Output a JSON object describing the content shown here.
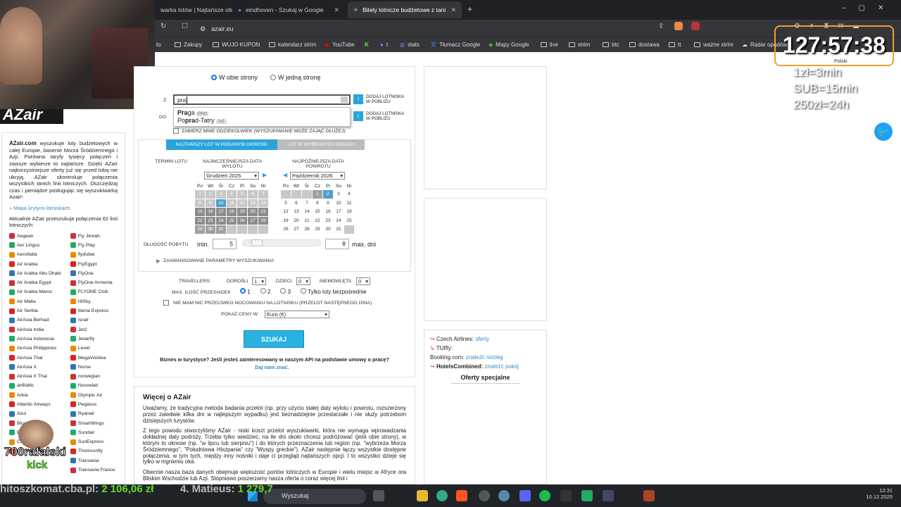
{
  "browser": {
    "tabs": [
      "warka lotów | Najtańsze ofer",
      "eindhoven - Szukaj w Google",
      "Bilety lotnicze budżetowe z tani"
    ],
    "url": "azair.eu",
    "bookmarks": [
      "to",
      "Zakupy",
      "WUJO KUPON",
      "kalendarz strim",
      "YouTube",
      "t",
      "stats",
      "Tłumacz Google",
      "Mapy Google",
      "live",
      "strim",
      "btc",
      "dostawa",
      "tt",
      "ważne strim",
      "Radar opadów",
      "Z"
    ]
  },
  "overlay": {
    "timer": "127:57:38",
    "rule1": "1zł=3min",
    "rule2": "SUB=15min",
    "rule3": "250zł=24h",
    "lang": "Polski"
  },
  "sidebar": {
    "brand": "AZair",
    "intro_bold": "AZair.com",
    "intro": "wyszukuje loty budżetowych w całej Europie, basenie Morza Śródziemnego i Azji. Porówna taryfy tysięcy połączeń i zawsze wybierze to najtańsze. Dzięki AZair najkorzystniejsze oferty już się przed tobą nie ukryją. AZair skontroluje połączenia wszystkich tanich linii lotniczych. Oszczędzaj czas i pieniądze posługując się wyszukiwarką Azair!",
    "map_link": "Mapa krytymi lotniskach",
    "count_text": "Aktualnie AZair przeszukuje połączenia 62 linii lotniczych:",
    "airlines_left": [
      "Aegean",
      "Aer Lingus",
      "AeroItalia",
      "Air Arabia",
      "Air Arabia Abu Dhabi",
      "Air Arabia Egypt",
      "Air Arabia Maroc",
      "Air Malta",
      "Air Serbia",
      "AirAsia Berhad",
      "AirAsia India",
      "AirAsia Indonesia",
      "AirAsia Philippines",
      "AirAsia Thai",
      "AirAsia X",
      "AirAsia X Thai",
      "airBaltic",
      "Arkia",
      "Atlantic Airways",
      "Azul",
      "Blue Air",
      "Blue Islands",
      "Condor",
      "Corendon Dutch"
    ],
    "airlines_right": [
      "Fly Jinnah",
      "Fly Play",
      "flydubai",
      "FlyEgypt",
      "FlyOne",
      "FlyOne Armenia",
      "FLYONE Club",
      "HiSky",
      "Iberia Express",
      "Israir",
      "Jet2",
      "Jetairfly",
      "Level",
      "MegaVolotea",
      "Norse",
      "norwegian",
      "Nouvelair",
      "Olympic Air",
      "Pegasus",
      "Ryanair",
      "SmartWings",
      "Sundair",
      "SunExpress",
      "Thomsonfly",
      "Transavia",
      "Transavia France"
    ]
  },
  "form": {
    "round_trip": "W obie strony",
    "one_way": "W jedną stronę",
    "from_label": "Z",
    "from_value": "pra",
    "to_label": "DO",
    "nearby": "DODAJ LOTNISKA W POBLIŻU",
    "suggestions": [
      {
        "pre": "",
        "bold": "Pra",
        "post": "ga",
        "code": "PRG"
      },
      {
        "pre": "Po",
        "bold": "pra",
        "post": "d-Tatry",
        "code": "TAT"
      }
    ],
    "anywhere": "ZABIERZ MNIE GDZIEKOLWIEK (WYSZUKIWANIE MOŻE ZAJĄĆ DŁUŻEJ)",
    "tab1": "NAJTAŃSZY LOT W PODANYM OKRESIE",
    "tab2": "LOT W WYBRANYCH DNIACH",
    "term_label": "TERMIN LOTU",
    "earliest_label": "NAJWCZEŚNIEJSZA DATA WYLOTU",
    "latest_label": "NAJPÓŹNIEJSZA DATA POWROTU",
    "month1": "Grudzień 2025",
    "month2": "Październik 2026",
    "weekdays": [
      "Po",
      "Wt",
      "Śr",
      "Cz",
      "Pi",
      "So",
      "Ni"
    ],
    "cal1": [
      [
        "1",
        "2",
        "3",
        "4",
        "5",
        "6",
        "7"
      ],
      [
        "8",
        "9",
        "10",
        "11",
        "12",
        "13",
        "14"
      ],
      [
        "15",
        "16",
        "17",
        "18",
        "19",
        "20",
        "21"
      ],
      [
        "22",
        "23",
        "24",
        "25",
        "26",
        "27",
        "28"
      ],
      [
        "29",
        "30",
        "31",
        "",
        "",
        "",
        ""
      ]
    ],
    "cal2": [
      [
        "",
        "",
        "",
        "1",
        "2",
        "3",
        "4"
      ],
      [
        "5",
        "6",
        "7",
        "8",
        "9",
        "10",
        "11"
      ],
      [
        "12",
        "13",
        "14",
        "15",
        "16",
        "17",
        "18"
      ],
      [
        "19",
        "20",
        "21",
        "22",
        "23",
        "24",
        "25"
      ],
      [
        "26",
        "27",
        "28",
        "29",
        "30",
        "31",
        ""
      ]
    ],
    "stay_label": "DŁUGOŚĆ POBYTU",
    "min_label": "min.",
    "min_value": "5",
    "max_value": "8",
    "max_label": "max. dni",
    "advanced": "ZAAWANSOWANE PARAMETRY WYSZUKIWANIA",
    "travellers": "TRAVELLERS:",
    "adults_label": "DOROŚLI",
    "adults": "1",
    "children_label": "DZIECI",
    "children": "0",
    "infants_label": "NIEMOWLĘTA",
    "infants": "0",
    "changes_label": "MAX. ILOŚĆ PRZESIADEK",
    "c1": "1",
    "c2": "2",
    "c3": "3",
    "direct": "Tylko loty bezpośrednie",
    "overnight": "NIE MAM NIC PRZECIWKO NOCOWANIU NA LOTNISKU (PRZELOT NASTĘPNEGO DNIA)",
    "currency_label": "POKAŻ CENY W",
    "currency": "Euro (€)",
    "search": "SZUKAJ",
    "biz": "Biznes w turystyce? Jeśli jesteś zainteresowany w naszym API na podstawie umowy o pracę?",
    "biz_link": "Daj nam znać."
  },
  "right": {
    "l1a": "Czech Airlines:",
    "l1b": "oferty",
    "l2": "TUIfly:",
    "l3a": "Booking.com:",
    "l3b": "znaleźć nocleg",
    "l4a": "HotelsCombined:",
    "l4b": "znaleźć pokój",
    "special": "Oferty specjalne"
  },
  "more": {
    "title": "Więcej o AZair",
    "p1": "Uważamy, że tradycyjna metoda badania przelot (np. przy użyciu stałej daty wylotu i powrotu, rozszerzony przez zaledwie kilka dni w najlepszym wypadku) jest beznadziejnie przestarzałe i nie służy potrzebom dzisiejszych turystów.",
    "p2": "Z tego powodu stworzyliśmy AZair - niski koszt przelot wyszukiwarki, która nie wymaga wprowadzania dokładnej daty podróży. Trzeba tylko wiedzieć, na ile dni około chcesz podróżować (jeśli obie strony), w którym to okresie (np. \"w lipcu lub sierpniu\") i do których przeznaczenia lub region (np. \"wybrzeża Morza Śródziemnego\", \"Południowa Hiszpania\" czy \"Wyspy greckie\"). AZair następnie łączy wszystkie dostępne połączenia, w tym tych, między inny nośniki i daje ci przegląd najtańszych opcji. I to wszystko dzieje się tylko w mgnieniu oka.",
    "p3": "Obecnie nasza baza danych obejmuje większość portów lotniczych w Europie i wielu miejsc w Afryce ora Bliskim Wschodzie lub Azji. Stopniowo poszerzamy nasza oferta o coraz więcej linii i"
  },
  "stream": {
    "ticker1": "hitoszkomat.cba.pl:",
    "ticker2": "2 106,06 zł",
    "ticker3": "4. Matieus:",
    "ticker4": "1 279,7",
    "name": "700rafalski",
    "kick": "kick"
  },
  "taskbar": {
    "search": "Wyszukaj",
    "time": "12:31",
    "date": "10.12.2025"
  }
}
